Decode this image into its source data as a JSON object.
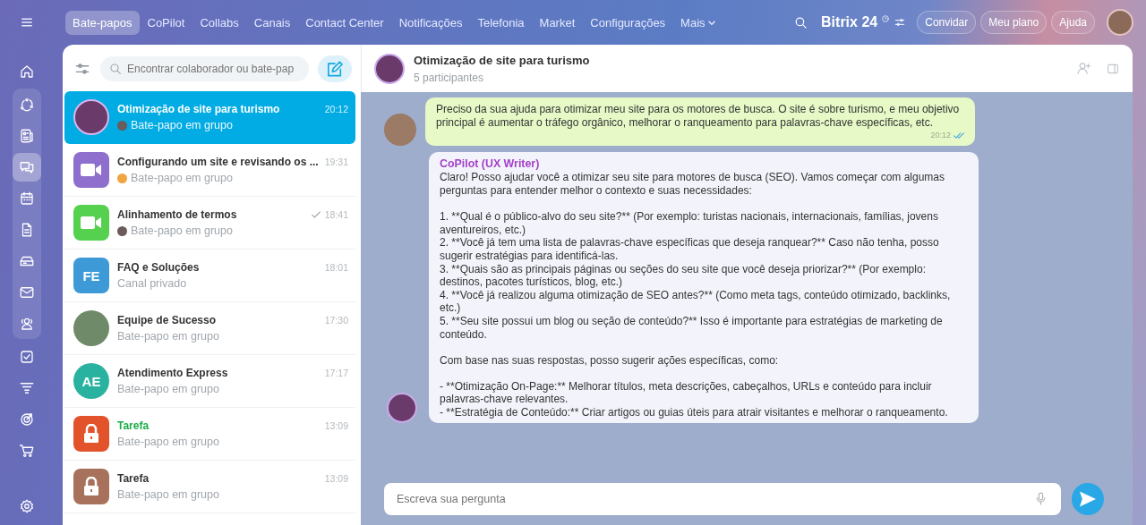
{
  "top_nav": {
    "tabs": [
      {
        "label": "Bate-papos",
        "selected": true
      },
      {
        "label": "CoPilot",
        "selected": false
      },
      {
        "label": "Collabs",
        "selected": false
      },
      {
        "label": "Canais",
        "selected": false
      },
      {
        "label": "Contact Center",
        "selected": false
      },
      {
        "label": "Notificações",
        "selected": false
      },
      {
        "label": "Telefonia",
        "selected": false
      },
      {
        "label": "Market",
        "selected": false
      },
      {
        "label": "Configurações",
        "selected": false
      }
    ],
    "more": "Mais",
    "logo": {
      "name": "Bitrix",
      "number": "24"
    },
    "buttons": [
      "Convidar",
      "Meu plano",
      "Ajuda"
    ]
  },
  "rail": [
    {
      "kind": "home",
      "selected": false,
      "grouped": false
    },
    {
      "kind": "flow",
      "selected": false,
      "grouped": true
    },
    {
      "kind": "news",
      "selected": false,
      "grouped": true
    },
    {
      "kind": "chat",
      "selected": true,
      "grouped": true
    },
    {
      "kind": "calendar",
      "selected": false,
      "grouped": true
    },
    {
      "kind": "doc",
      "selected": false,
      "grouped": true
    },
    {
      "kind": "drive",
      "selected": false,
      "grouped": true
    },
    {
      "kind": "mail",
      "selected": false,
      "grouped": true
    },
    {
      "kind": "contacts",
      "selected": false,
      "grouped": true
    },
    {
      "kind": "task",
      "selected": false,
      "grouped": false
    },
    {
      "kind": "funnel",
      "selected": false,
      "grouped": false
    },
    {
      "kind": "target",
      "selected": false,
      "grouped": false
    },
    {
      "kind": "cart",
      "selected": false,
      "grouped": false
    }
  ],
  "chat_list": {
    "search": {
      "placeholder": "Encontrar colaborador ou bate-pap"
    },
    "items": [
      {
        "title": "Otimização de site para turismo",
        "subtitle": "Bate-papo em grupo",
        "time": "20:12",
        "avatar": {
          "kind": "photo",
          "color": "#6a3a6a"
        },
        "sub_avatar": {
          "kind": "photo"
        },
        "read": false,
        "highlighted": false,
        "selected": true
      },
      {
        "title": "Configurando um site e revisando os ...",
        "subtitle": "Bate-papo em grupo",
        "time": "19:31",
        "avatar": {
          "kind": "video",
          "color": "#8e6fce"
        },
        "sub_avatar": {
          "kind": "bot"
        },
        "read": false,
        "highlighted": false,
        "selected": false
      },
      {
        "title": "Alinhamento de termos",
        "subtitle": "Bate-papo em grupo",
        "time": "18:41",
        "avatar": {
          "kind": "video",
          "color": "#55d04f"
        },
        "sub_avatar": {
          "kind": "photo"
        },
        "read": true,
        "highlighted": false,
        "selected": false
      },
      {
        "title": "FAQ e Soluções",
        "subtitle": "Canal privado",
        "time": "18:01",
        "avatar": {
          "kind": "square_initials",
          "initials": "FE",
          "color": "#3e9ad6"
        },
        "read": false,
        "highlighted": false,
        "selected": false
      },
      {
        "title": "Equipe de Sucesso",
        "subtitle": "Bate-papo em grupo",
        "time": "17:30",
        "avatar": {
          "kind": "landscape",
          "color": "#6f8a68"
        },
        "read": false,
        "highlighted": false,
        "selected": false
      },
      {
        "title": "Atendimento Express",
        "subtitle": "Bate-papo em grupo",
        "time": "17:17",
        "avatar": {
          "kind": "round_initials",
          "initials": "AE",
          "color": "#29b2a0"
        },
        "read": false,
        "highlighted": false,
        "selected": false
      },
      {
        "title": "Tarefa",
        "subtitle": "Bate-papo em grupo",
        "time": "13:09",
        "avatar": {
          "kind": "lock",
          "color": "#e2532c"
        },
        "read": false,
        "highlighted": true,
        "selected": false
      },
      {
        "title": "Tarefa",
        "subtitle": "Bate-papo em grupo",
        "time": "13:09",
        "avatar": {
          "kind": "lock",
          "color": "#a8715c"
        },
        "read": false,
        "highlighted": false,
        "selected": false
      }
    ]
  },
  "chat": {
    "title": "Otimização de site para turismo",
    "subtitle": "5 participantes",
    "messages": [
      {
        "kind": "own",
        "text": "Preciso da sua ajuda para otimizar meu site para os motores de busca. O site é sobre turismo, e meu objetivo principal é aumentar o tráfego orgânico, melhorar o ranqueamento para palavras-chave específicas, etc.",
        "time": "20:12",
        "read": true
      },
      {
        "kind": "bot",
        "author": "CoPilot (UX Writer)",
        "text": "Claro! Posso ajudar você a otimizar seu site para motores de busca (SEO). Vamos começar com algumas perguntas para entender melhor o contexto e suas necessidades:\n\n1. **Qual é o público-alvo do seu site?** (Por exemplo: turistas nacionais, internacionais, famílias, jovens aventureiros, etc.)\n2. **Você já tem uma lista de palavras-chave específicas que deseja ranquear?** Caso não tenha, posso sugerir estratégias para identificá-las.\n3. **Quais são as principais páginas ou seções do seu site que você deseja priorizar?** (Por exemplo: destinos, pacotes turísticos, blog, etc.)\n4. **Você já realizou alguma otimização de SEO antes?** (Como meta tags, conteúdo otimizado, backlinks, etc.)\n5. **Seu site possui um blog ou seção de conteúdo?** Isso é importante para estratégias de marketing de conteúdo.\n\nCom base nas suas respostas, posso sugerir ações específicas, como:\n\n- **Otimização On-Page:** Melhorar títulos, meta descrições, cabeçalhos, URLs e conteúdo para incluir palavras-chave relevantes.\n- **Estratégia de Conteúdo:** Criar artigos ou guias úteis para atrair visitantes e melhorar o ranqueamento."
      }
    ],
    "composer": {
      "placeholder": "Escreva sua pergunta"
    }
  }
}
